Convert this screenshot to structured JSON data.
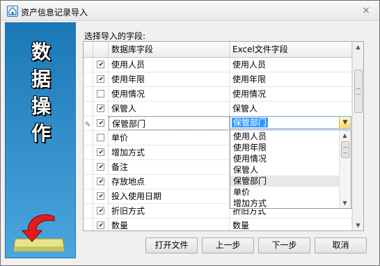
{
  "window": {
    "title": "资产信息记录导入",
    "close_glyph": "×"
  },
  "left_panel": {
    "chars": [
      "数",
      "据",
      "操",
      "作"
    ],
    "graphic_icon": "import-arrow-icon"
  },
  "section_label": "选择导入的字段:",
  "grid": {
    "headers": {
      "db_field": "数据库字段",
      "excel_field": "Excel文件字段"
    },
    "rows": [
      {
        "checked": true,
        "db": "使用人员",
        "excel": "使用人员"
      },
      {
        "checked": true,
        "db": "使用年限",
        "excel": "使用年限"
      },
      {
        "checked": false,
        "db": "使用情况",
        "excel": "使用情况"
      },
      {
        "checked": true,
        "db": "保管人",
        "excel": "保管人"
      },
      {
        "checked": true,
        "db": "保管部门",
        "excel": "保管部门",
        "editing": true
      },
      {
        "checked": false,
        "db": "单价",
        "excel": ""
      },
      {
        "checked": true,
        "db": "增加方式",
        "excel": ""
      },
      {
        "checked": true,
        "db": "备注",
        "excel": ""
      },
      {
        "checked": true,
        "db": "存放地点",
        "excel": ""
      },
      {
        "checked": true,
        "db": "投入使用日期",
        "excel": ""
      },
      {
        "checked": true,
        "db": "折旧方式",
        "excel": "折旧方式"
      },
      {
        "checked": true,
        "db": "数量",
        "excel": "数量"
      }
    ]
  },
  "combo": {
    "value": "保管部门",
    "options": [
      "使用人员",
      "使用年限",
      "使用情况",
      "保管人",
      "保管部门",
      "单价",
      "增加方式"
    ]
  },
  "buttons": {
    "open_file": "打开文件",
    "prev": "上一步",
    "next": "下一步",
    "cancel": "取消"
  },
  "colors": {
    "accent_blue": "#1b78b7",
    "selection": "#3399ff"
  }
}
